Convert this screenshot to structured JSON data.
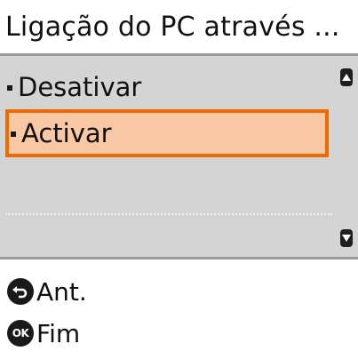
{
  "header": {
    "title": "Ligação do PC através ..."
  },
  "list": {
    "items": [
      {
        "label": "Desativar",
        "selected": false
      },
      {
        "label": "Activar",
        "selected": true
      }
    ],
    "scroll_up_icon": "scroll-up-arrow-icon",
    "scroll_down_icon": "scroll-down-arrow-icon"
  },
  "softkeys": {
    "back_label": "Ant.",
    "back_icon": "back-arrow-icon",
    "ok_label": "Fim",
    "ok_icon_text": "OK"
  },
  "colors": {
    "list_background": "#d4d4d4",
    "selection_fill": "#f8c7a4",
    "selection_border": "#ee6a00",
    "separator": "#9a9a9a"
  }
}
